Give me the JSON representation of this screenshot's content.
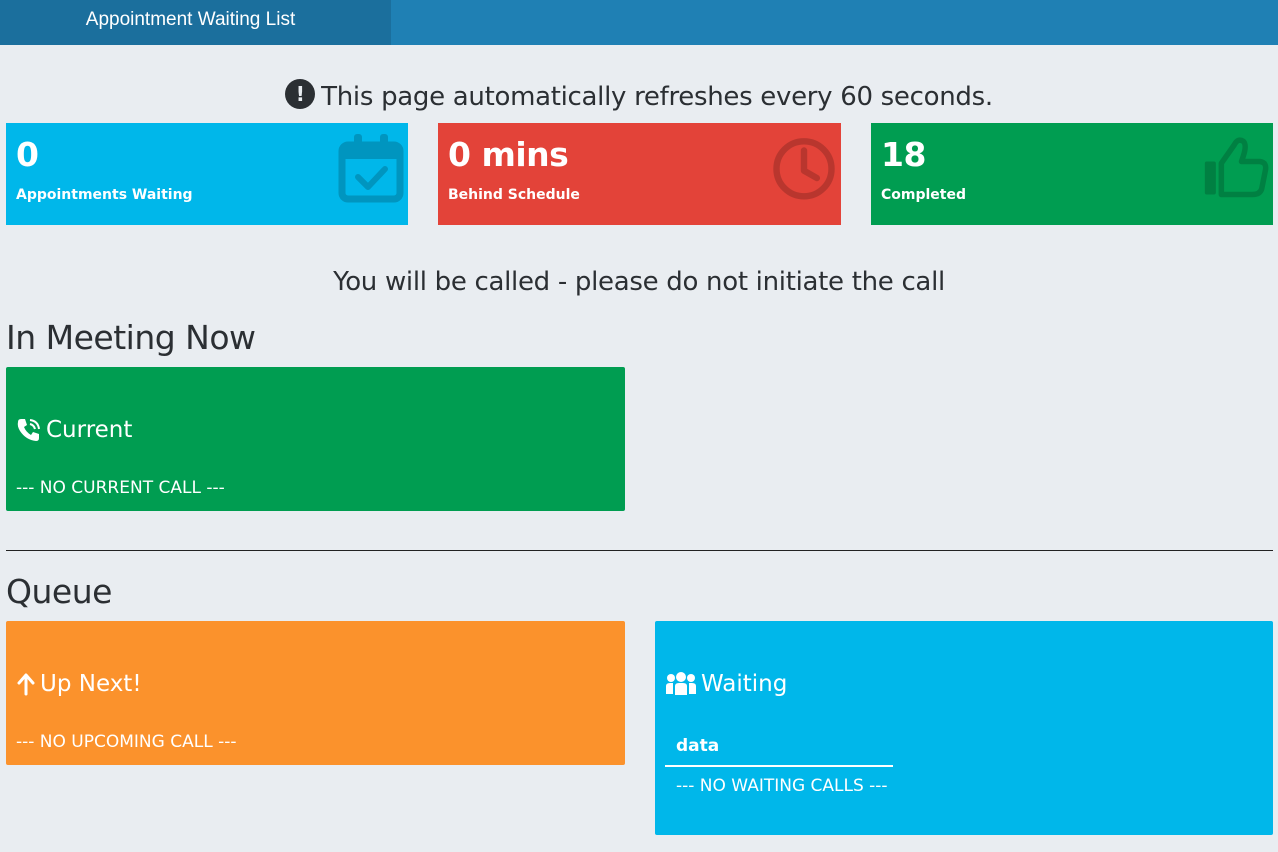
{
  "header": {
    "tab_label": "Appointment Waiting List",
    "bar_color": "#1f80b4",
    "tab_color": "#1b6f9d"
  },
  "refresh_notice": {
    "icon": "exclamation-circle-icon",
    "text": "This page automatically refreshes every 60 seconds."
  },
  "stats": [
    {
      "value": "0",
      "label": "Appointments Waiting",
      "icon": "calendar-check-icon",
      "color": "#00b7ea"
    },
    {
      "value": "0 mins",
      "label": "Behind Schedule",
      "icon": "clock-icon",
      "color": "#e34339"
    },
    {
      "value": "18",
      "label": "Completed",
      "icon": "thumbs-up-icon",
      "color": "#009d51"
    }
  ],
  "call_notice": "You will be called - please do not initiate the call",
  "in_meeting": {
    "heading": "In Meeting Now",
    "current": {
      "title": "Current",
      "icon": "phone-call-icon",
      "empty_text": "--- NO CURRENT CALL ---",
      "color": "#009d51"
    }
  },
  "queue": {
    "heading": "Queue",
    "up_next": {
      "title": "Up Next!",
      "icon": "arrow-up-icon",
      "empty_text": "--- NO UPCOMING CALL ---",
      "color": "#fb922c"
    },
    "waiting": {
      "title": "Waiting",
      "icon": "users-icon",
      "column_header": "data",
      "empty_text": "--- NO WAITING CALLS ---",
      "color": "#00b7ea"
    }
  }
}
